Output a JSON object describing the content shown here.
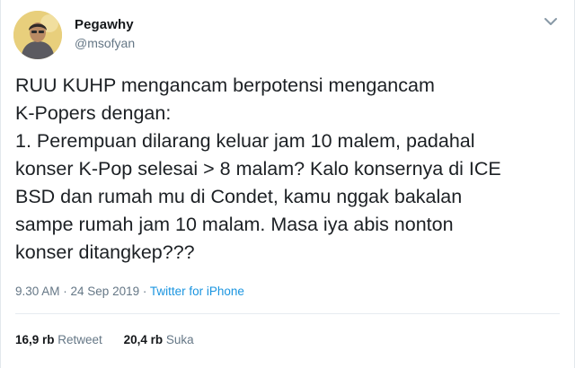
{
  "author": {
    "display_name": "Pegawhy",
    "handle": "@msofyan"
  },
  "tweet": {
    "lines": [
      "RUU KUHP mengancam berpotensi mengancam",
      "K-Popers dengan:",
      "1. Perempuan dilarang keluar jam 10 malem, padahal",
      "konser K-Pop selesai > 8 malam? Kalo konsernya di ICE",
      "BSD dan rumah mu di Condet, kamu nggak bakalan",
      "sampe rumah jam 10 malam. Masa iya abis nonton",
      "konser ditangkep???"
    ],
    "timestamp": "9.30 AM · 24 Sep 2019 ·",
    "source": "Twitter for iPhone"
  },
  "stats": {
    "retweets_count": "16,9 rb",
    "retweets_label": "Retweet",
    "likes_count": "20,4 rb",
    "likes_label": "Suka"
  },
  "icons": {
    "menu": "chevron-down-icon",
    "avatar": "profile-photo"
  },
  "colors": {
    "link": "#1b95e0",
    "secondary_text": "#657786",
    "primary_text": "#14171a"
  }
}
